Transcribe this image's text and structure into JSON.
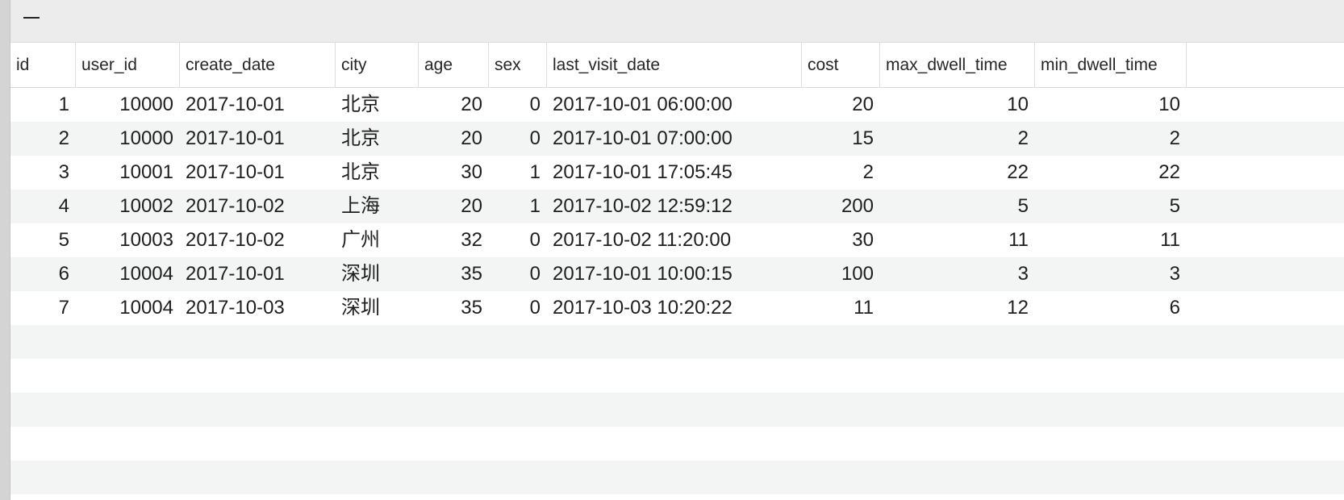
{
  "toolbar": {
    "collapse_icon": "minus-icon"
  },
  "table": {
    "columns": [
      {
        "key": "id",
        "label": "id",
        "align": "num"
      },
      {
        "key": "user_id",
        "label": "user_id",
        "align": "num"
      },
      {
        "key": "create_date",
        "label": "create_date",
        "align": "txt"
      },
      {
        "key": "city",
        "label": "city",
        "align": "txt"
      },
      {
        "key": "age",
        "label": "age",
        "align": "num"
      },
      {
        "key": "sex",
        "label": "sex",
        "align": "num"
      },
      {
        "key": "last_visit_date",
        "label": "last_visit_date",
        "align": "txt"
      },
      {
        "key": "cost",
        "label": "cost",
        "align": "num"
      },
      {
        "key": "max_dwell_time",
        "label": "max_dwell_time",
        "align": "num"
      },
      {
        "key": "min_dwell_time",
        "label": "min_dwell_time",
        "align": "num"
      }
    ],
    "rows": [
      [
        "1",
        "10000",
        "2017-10-01",
        "北京",
        "20",
        "0",
        "2017-10-01 06:00:00",
        "20",
        "10",
        "10"
      ],
      [
        "2",
        "10000",
        "2017-10-01",
        "北京",
        "20",
        "0",
        "2017-10-01 07:00:00",
        "15",
        "2",
        "2"
      ],
      [
        "3",
        "10001",
        "2017-10-01",
        "北京",
        "30",
        "1",
        "2017-10-01 17:05:45",
        "2",
        "22",
        "22"
      ],
      [
        "4",
        "10002",
        "2017-10-02",
        "上海",
        "20",
        "1",
        "2017-10-02 12:59:12",
        "200",
        "5",
        "5"
      ],
      [
        "5",
        "10003",
        "2017-10-02",
        "广州",
        "32",
        "0",
        "2017-10-02 11:20:00",
        "30",
        "11",
        "11"
      ],
      [
        "6",
        "10004",
        "2017-10-01",
        "深圳",
        "35",
        "0",
        "2017-10-01 10:00:15",
        "100",
        "3",
        "3"
      ],
      [
        "7",
        "10004",
        "2017-10-03",
        "深圳",
        "35",
        "0",
        "2017-10-03 10:20:22",
        "11",
        "12",
        "6"
      ]
    ],
    "empty_row_count": 5
  }
}
